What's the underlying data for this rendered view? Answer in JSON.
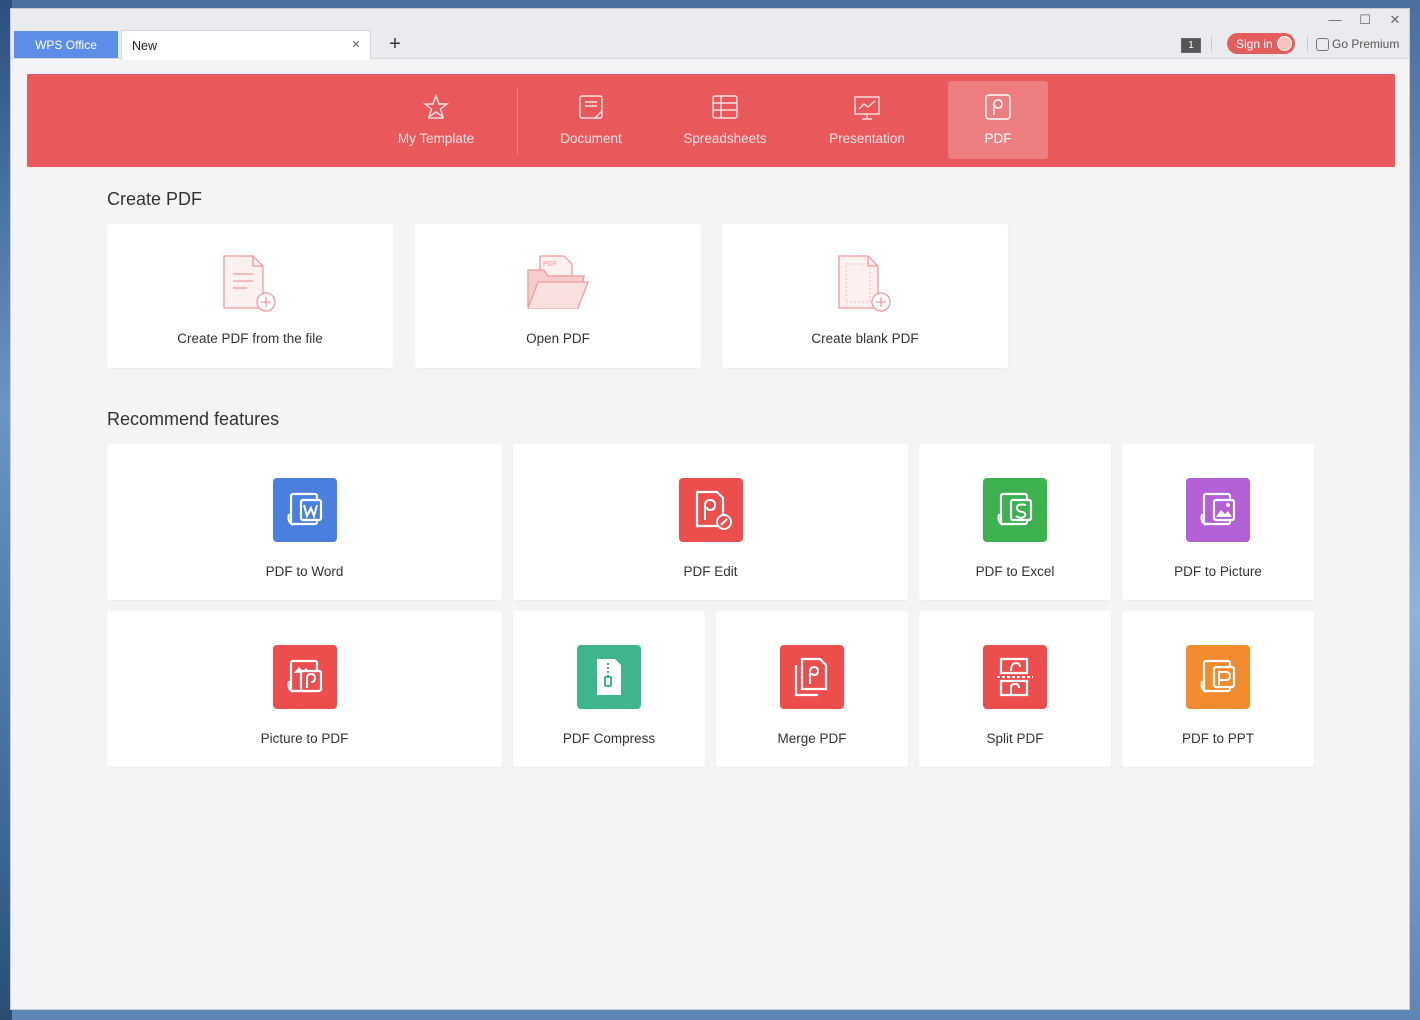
{
  "titlebar": {
    "app_tab": "WPS Office",
    "doc_tab": "New",
    "tab_close": "×",
    "tab_add": "+",
    "counter": "1",
    "sign_in": "Sign in",
    "go_premium": "Go Premium",
    "minimize": "—",
    "maximize": "☐",
    "close": "✕"
  },
  "categories": [
    {
      "label": "My Template",
      "icon": "star-icon"
    },
    {
      "label": "Document",
      "icon": "document-icon"
    },
    {
      "label": "Spreadsheets",
      "icon": "spreadsheet-icon"
    },
    {
      "label": "Presentation",
      "icon": "presentation-icon"
    },
    {
      "label": "PDF",
      "icon": "pdf-icon",
      "active": true
    }
  ],
  "create_section": {
    "title": "Create PDF",
    "cards": [
      {
        "label": "Create PDF from the file",
        "icon": "file-add-icon"
      },
      {
        "label": "Open PDF",
        "icon": "open-folder-icon",
        "badge": "PDF"
      },
      {
        "label": "Create blank PDF",
        "icon": "blank-page-add-icon"
      }
    ]
  },
  "recommend_section": {
    "title": "Recommend features",
    "features": [
      {
        "label": "PDF to Word",
        "icon": "pdf-to-word-icon",
        "color": "#4a7fe0",
        "glyph": "W"
      },
      {
        "label": "PDF Edit",
        "icon": "pdf-edit-icon",
        "color": "#ec4e4e"
      },
      {
        "label": "PDF to Excel",
        "icon": "pdf-to-excel-icon",
        "color": "#3db04f",
        "glyph": "S"
      },
      {
        "label": "PDF to Picture",
        "icon": "pdf-to-picture-icon",
        "color": "#b35fd6"
      },
      {
        "label": "Picture to PDF",
        "icon": "picture-to-pdf-icon",
        "color": "#ec4e4e"
      },
      {
        "label": "PDF Compress",
        "icon": "pdf-compress-icon",
        "color": "#3fb58e"
      },
      {
        "label": "Merge PDF",
        "icon": "merge-pdf-icon",
        "color": "#ec4e4e"
      },
      {
        "label": "Split PDF",
        "icon": "split-pdf-icon",
        "color": "#ec4e4e"
      },
      {
        "label": "PDF to PPT",
        "icon": "pdf-to-ppt-icon",
        "color": "#f28a2e"
      }
    ]
  }
}
